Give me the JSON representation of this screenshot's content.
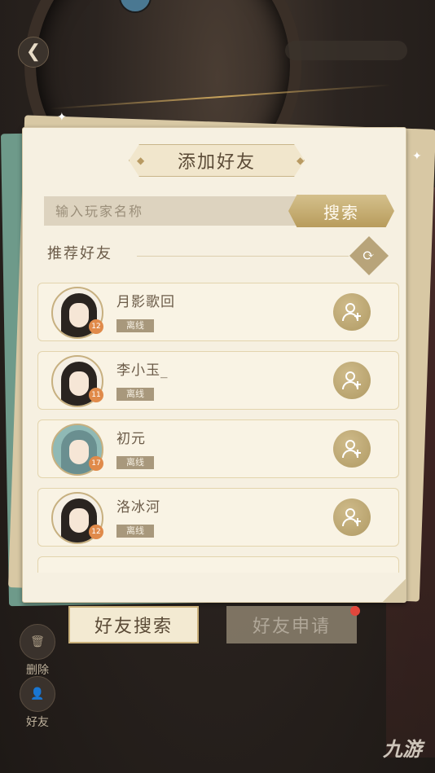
{
  "dialog": {
    "title": "添加好友",
    "search_placeholder": "输入玩家名称",
    "search_button": "搜索",
    "recommend_title": "推荐好友"
  },
  "friends": [
    {
      "name": "月影歌回",
      "status": "离线",
      "level": "12"
    },
    {
      "name": "李小玉_",
      "status": "离线",
      "level": "11"
    },
    {
      "name": "初元",
      "status": "离线",
      "level": "17"
    },
    {
      "name": "洛冰河",
      "status": "离线",
      "level": "12"
    }
  ],
  "tabs": {
    "search_label": "好友搜索",
    "request_label": "好友申请"
  },
  "sidebar": {
    "delete_label": "删除",
    "friends_label": "好友"
  },
  "watermark": "九游"
}
